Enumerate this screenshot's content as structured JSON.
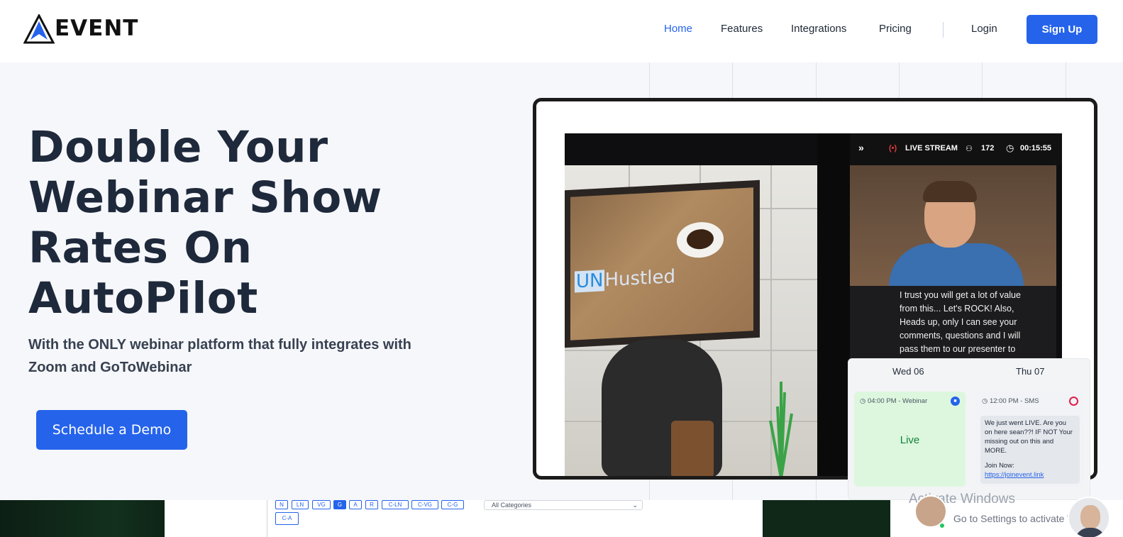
{
  "brand": {
    "logo_text": "EVENT"
  },
  "nav": {
    "items": [
      {
        "label": "Home",
        "active": true
      },
      {
        "label": "Features"
      },
      {
        "label": "Integrations"
      },
      {
        "label": "Pricing"
      }
    ],
    "login_label": "Login",
    "signup_label": "Sign Up"
  },
  "hero": {
    "headline_lines": [
      "Double Your",
      "Webinar Show",
      "Rates On",
      "AutoPilot"
    ],
    "subline_lines": [
      "With the ONLY webinar platform that fully integrates with",
      "Zoom and GoToWebinar"
    ],
    "cta_label": "Schedule a Demo"
  },
  "stream": {
    "live_label": "LIVE STREAM",
    "viewers": "172",
    "timer": "00:15:55",
    "room_brand_prefix": "UN",
    "room_brand_suffix": "Hustled",
    "chat_text": "I trust you will get a lot of value from this... Let's ROCK! Also, Heads up, only I can see your comments, questions and I will pass them to our presenter to"
  },
  "schedule": {
    "day1": "Wed 06",
    "day2": "Thu 07",
    "event1_time": "04:00 PM - Webinar",
    "event1_status": "Live",
    "event2_time": "12:00 PM - SMS",
    "event2_message": "We just went LIVE. Are you on here sean??! IF NOT Your missing out on this and MORE.",
    "event2_join": "Join Now:",
    "event2_link": "https://joinevent.link"
  },
  "bottom": {
    "filter_chips": [
      "N",
      "LN",
      "VG",
      "G",
      "A",
      "R",
      "C-LN",
      "C-VG",
      "C-G"
    ],
    "filter_chip_row2": "C-A",
    "selected_chip": "G",
    "category_select": "All Categories",
    "activate_title": "Activate Windows",
    "activate_sub": "Go to Settings to activate Windows."
  },
  "colors": {
    "accent": "#2563eb",
    "headline": "#1e293b",
    "live_green": "#15803d"
  }
}
